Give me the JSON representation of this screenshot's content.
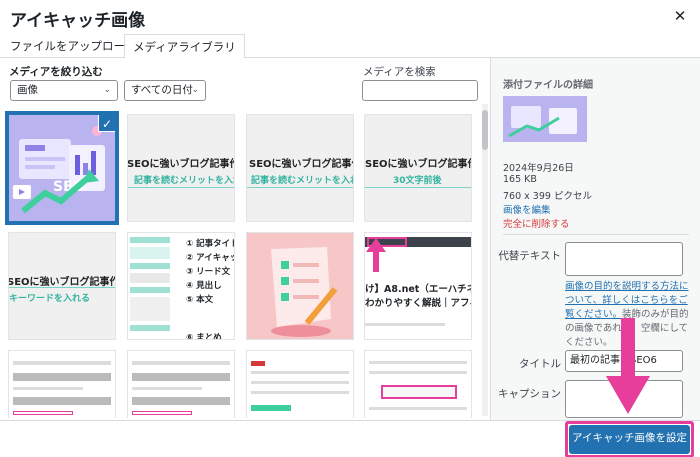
{
  "modal": {
    "title": "アイキャッチ画像",
    "close_icon": "close-icon"
  },
  "tabs": [
    {
      "label": "ファイルをアップロード"
    },
    {
      "label": "メディアライブラリ"
    }
  ],
  "filters": {
    "label": "メディアを絞り込む",
    "type_select": "画像",
    "date_select": "すべての日付",
    "search_label": "メディアを検索",
    "search_value": ""
  },
  "grid": {
    "thumbs": [
      {
        "caption": "",
        "selected": true
      },
      {
        "caption": ""
      },
      {
        "caption": ""
      },
      {
        "caption": ""
      },
      {
        "caption": "SEOに強いブログ記事作成プロ",
        "sub": "キーワードを入れる"
      },
      {
        "caption": "SEOに強いブログ記事作成プロ",
        "sub": "記事を読むメリットを入れる"
      },
      {
        "caption": "SEOに強いブログ記事作成プロ",
        "sub": ""
      },
      {
        "caption": "SEOに強いブログ記事作成プロ",
        "sub": "30文字前後"
      },
      {
        "caption": "SEOに強いブログ記事作成プロ",
        "sub": ""
      }
    ],
    "outline_items": [
      "① 記事タイトル",
      "② アイキャッ",
      "③ リード文",
      "④ 見出し",
      "⑤ 本文",
      "⑥ まとめ"
    ],
    "article_line1": "け】A8.net（エーハチネット）",
    "article_line2": "わかりやすく解説｜アフィリエ"
  },
  "sidebar": {
    "heading": "添付ファイルの詳細",
    "date": "2024年9月26日",
    "size": "165 KB",
    "dimensions": "760 x 399 ピクセル",
    "edit_link": "画像を編集",
    "delete_link": "完全に削除する",
    "alt_label": "代替テキスト",
    "alt_value": "",
    "help_link": "画像の目的を説明する方法について、詳しくはこちらをご覧ください。",
    "help_text": "装飾のみが目的の画像であれば、空欄にしてください。",
    "title_label": "タイトル",
    "title_value": "最初の記事のSEO6",
    "caption_label": "キャプション",
    "caption_value": ""
  },
  "footer": {
    "primary_button": "アイキャッチ画像を設定"
  },
  "colors": {
    "accent": "#2271b1",
    "highlight": "#e63e9a",
    "teal": "#34b3a0"
  }
}
